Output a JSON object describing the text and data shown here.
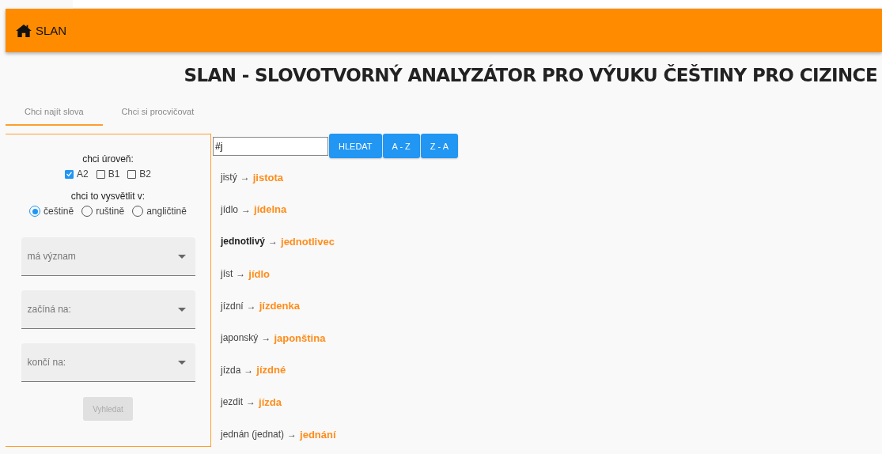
{
  "navbar": {
    "brand": "SLAN"
  },
  "title": "SLAN - SLOVOTVORNÝ ANALYZÁTOR PRO VÝUKU ČEŠTINY PRO CIZINCE",
  "tabs": [
    {
      "label": "Chci najít slova",
      "selected": true
    },
    {
      "label": "Chci si procvičovat",
      "selected": false
    }
  ],
  "filters": {
    "level_label": "chci úroveň:",
    "levels": [
      {
        "label": "A2",
        "checked": true
      },
      {
        "label": "B1",
        "checked": false
      },
      {
        "label": "B2",
        "checked": false
      }
    ],
    "language_label": "chci to vysvětlit v:",
    "languages": [
      {
        "label": "češtině",
        "selected": true
      },
      {
        "label": "ruštině",
        "selected": false
      },
      {
        "label": "angličtině",
        "selected": false
      }
    ],
    "dropdowns": [
      {
        "placeholder": "má význam"
      },
      {
        "placeholder": "začíná na:"
      },
      {
        "placeholder": "končí na:"
      }
    ],
    "submit": {
      "label": "Vyhledat",
      "disabled": true
    }
  },
  "search": {
    "value": "#j",
    "buttons": [
      "HLEDAT",
      "A - Z",
      "Z - A"
    ]
  },
  "results": [
    {
      "source": "jistý",
      "bold": false,
      "target": "jistota"
    },
    {
      "source": "jídlo",
      "bold": false,
      "target": "jídelna"
    },
    {
      "source": "jednotlivý",
      "bold": true,
      "target": "jednotlivec"
    },
    {
      "source": "jíst",
      "bold": false,
      "target": "jídlo"
    },
    {
      "source": "jízdní",
      "bold": false,
      "target": "jízdenka"
    },
    {
      "source": "japonský",
      "bold": false,
      "target": "japonština"
    },
    {
      "source": "jízda",
      "bold": false,
      "target": "jízdné"
    },
    {
      "source": "jezdit",
      "bold": false,
      "target": "jízda"
    },
    {
      "source": "jednán (jednat)",
      "bold": false,
      "target": "jednání"
    }
  ],
  "arrow": "→"
}
